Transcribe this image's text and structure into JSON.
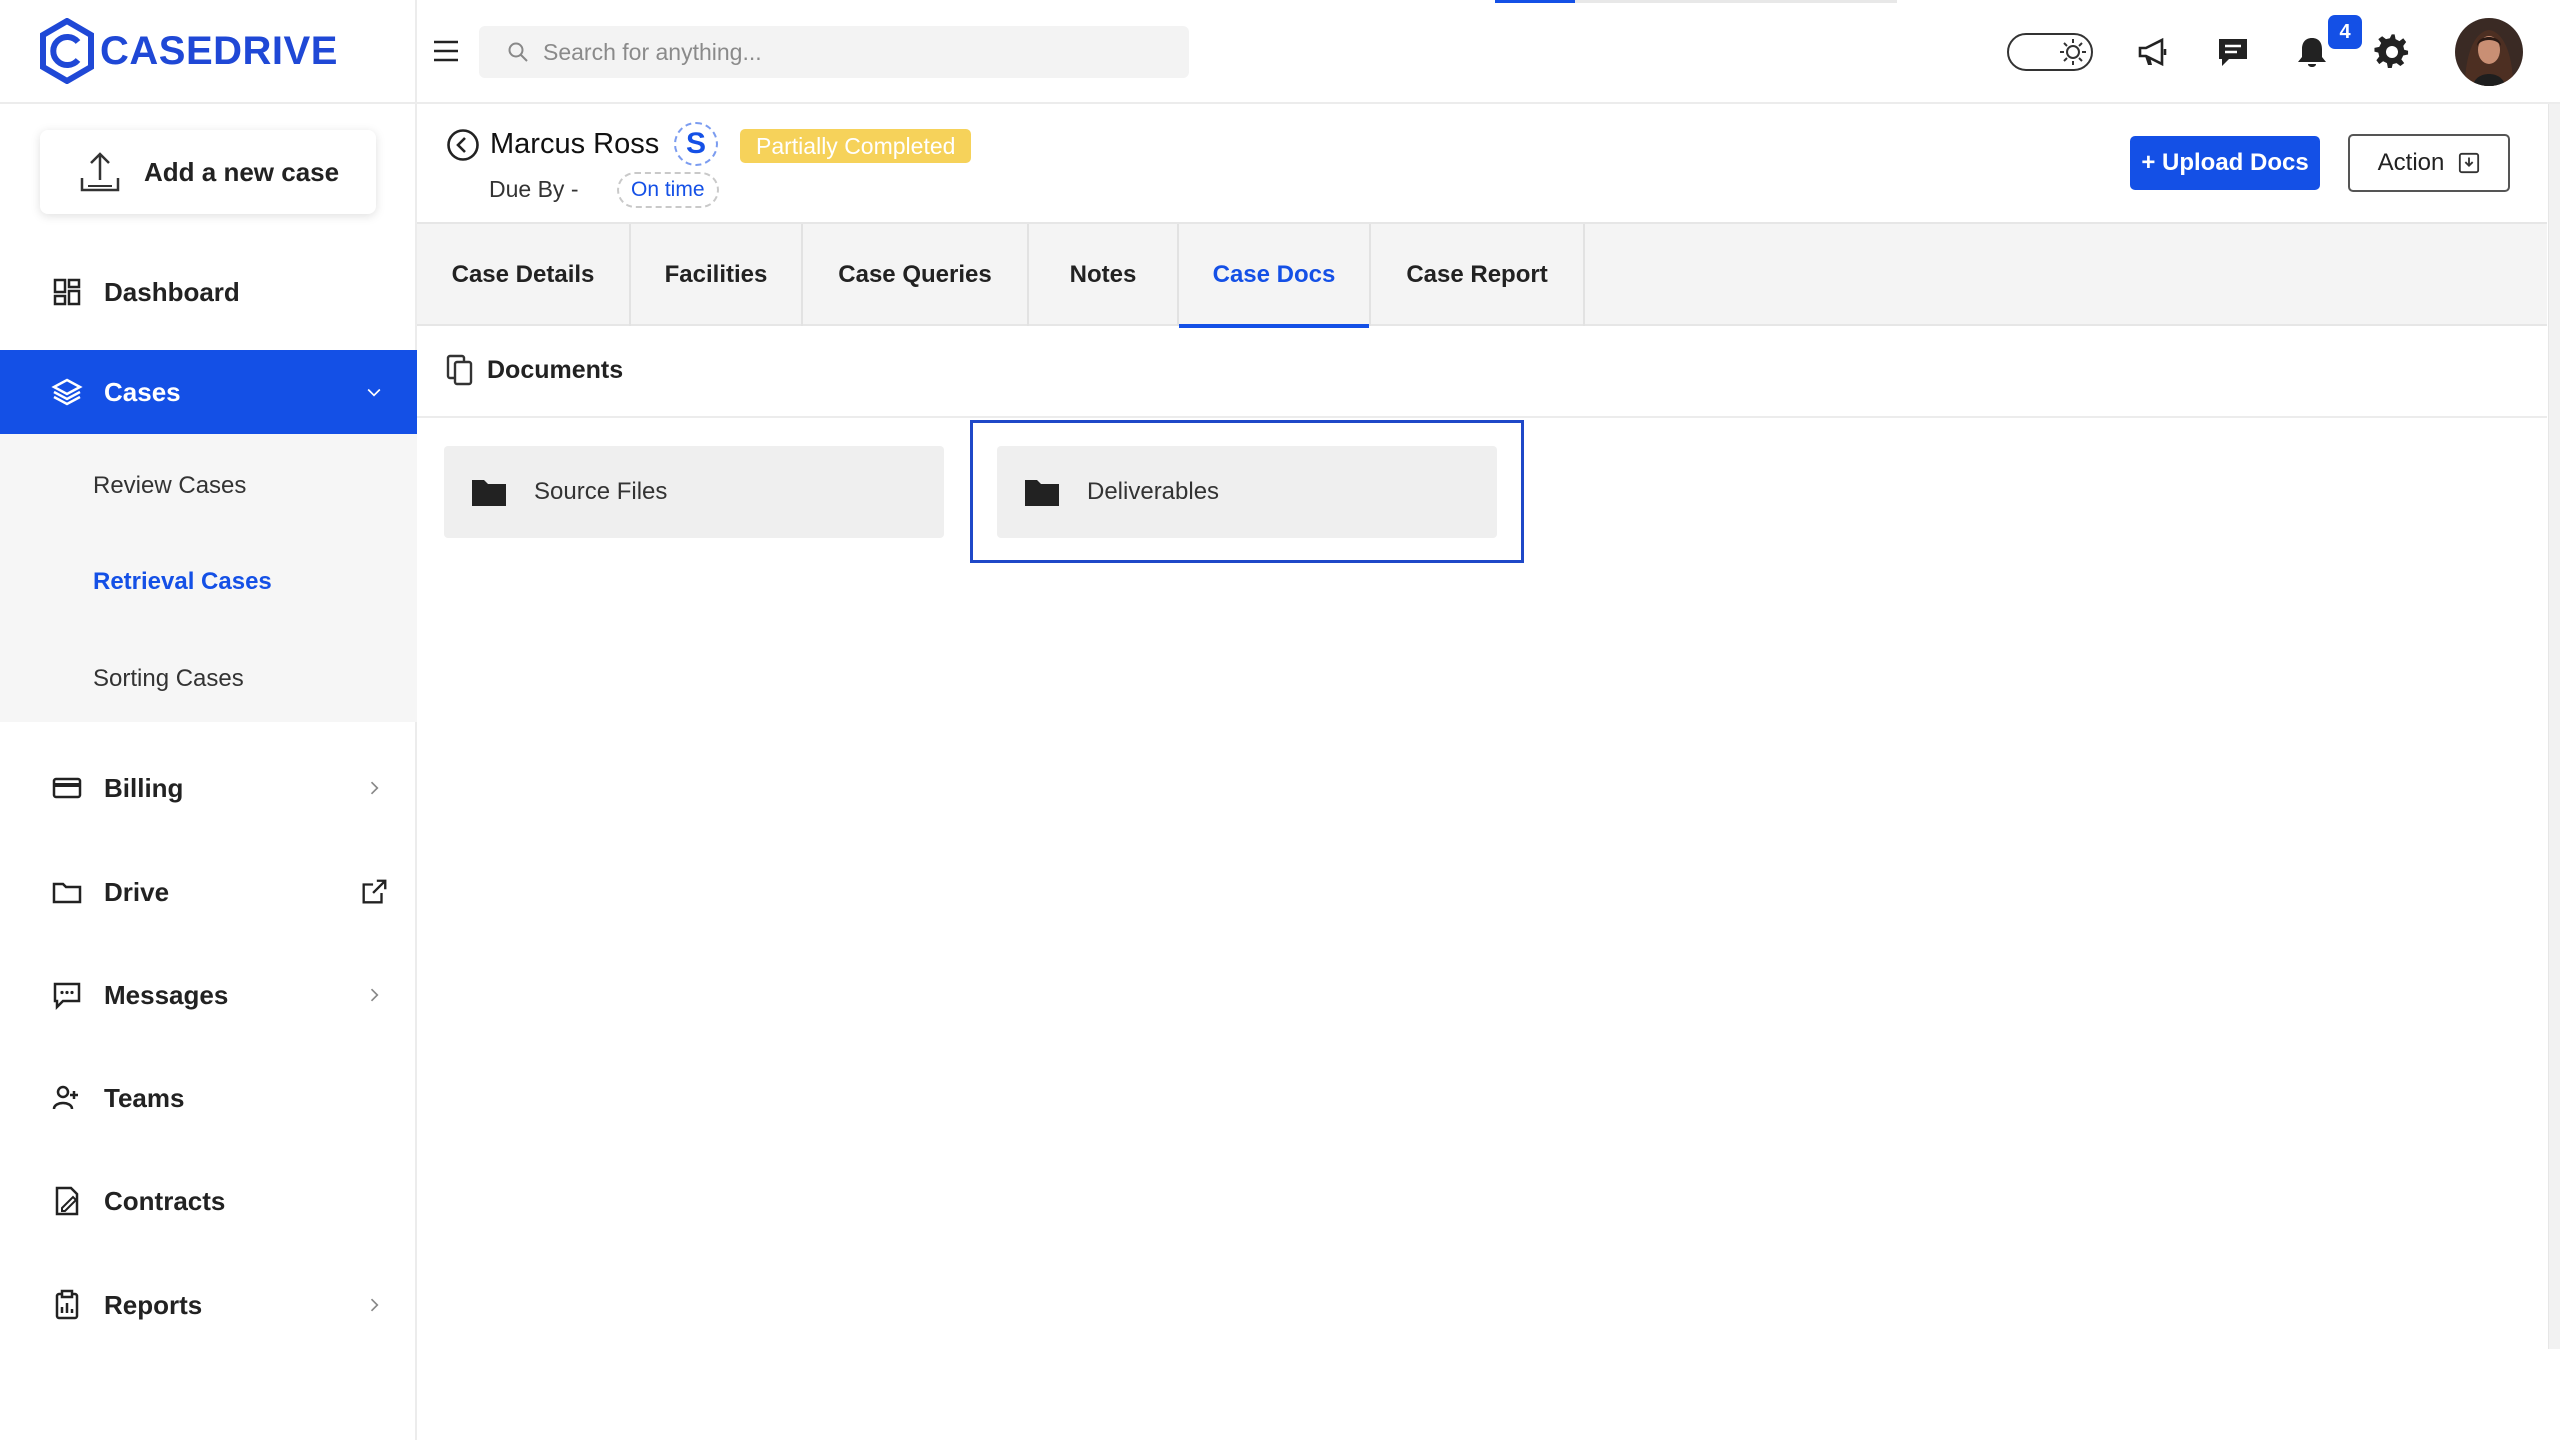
{
  "brand": {
    "name": "CASEDRIVE",
    "color": "#1f48d6"
  },
  "sidebar": {
    "add_case_label": "Add a new case",
    "items": [
      {
        "label": "Dashboard",
        "icon": "grid-icon"
      },
      {
        "label": "Cases",
        "icon": "layers-icon",
        "active": true
      },
      {
        "label": "Billing",
        "icon": "card-icon"
      },
      {
        "label": "Drive",
        "icon": "folder-icon"
      },
      {
        "label": "Messages",
        "icon": "message-icon"
      },
      {
        "label": "Teams",
        "icon": "users-icon"
      },
      {
        "label": "Contracts",
        "icon": "contract-icon"
      },
      {
        "label": "Reports",
        "icon": "clipboard-icon"
      }
    ],
    "subitems": [
      {
        "label": "Review Cases"
      },
      {
        "label": "Retrieval Cases",
        "active": true
      },
      {
        "label": "Sorting Cases"
      }
    ]
  },
  "topbar": {
    "search_placeholder": "Search for anything...",
    "notification_count": "4"
  },
  "case": {
    "name": "Marcus Ross",
    "initial": "S",
    "status": "Partially Completed",
    "due_label": "Due By -",
    "due_status": "On time",
    "upload_label": "+ Upload Docs",
    "action_label": "Action"
  },
  "tabs": [
    {
      "label": "Case Details"
    },
    {
      "label": "Facilities"
    },
    {
      "label": "Case Queries"
    },
    {
      "label": "Notes"
    },
    {
      "label": "Case Docs",
      "active": true
    },
    {
      "label": "Case Report"
    }
  ],
  "documents": {
    "title": "Documents",
    "folders": [
      {
        "label": "Source Files"
      },
      {
        "label": "Deliverables",
        "selected": true
      }
    ]
  },
  "colors": {
    "accent": "#1450e6",
    "status_badge": "#f6d25a",
    "sidebar_active": "#1450e6"
  }
}
